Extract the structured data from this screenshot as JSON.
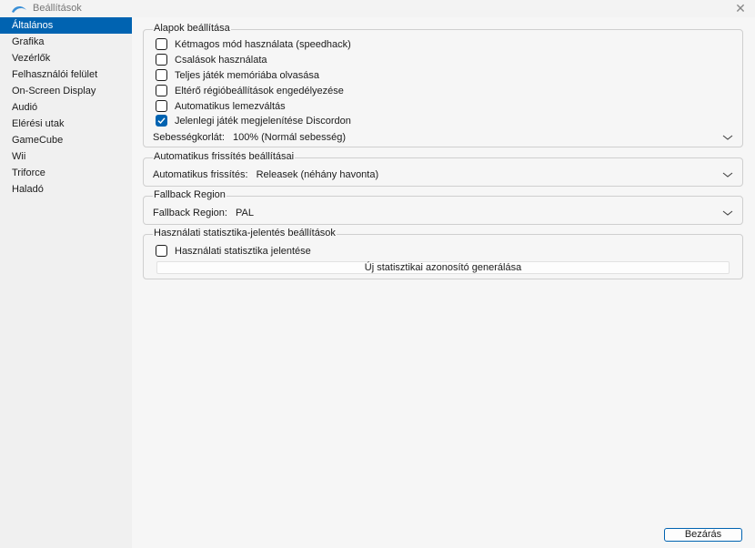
{
  "window": {
    "title": "Beállítások",
    "close_glyph": "✕"
  },
  "sidebar": {
    "items": [
      {
        "label": "Általános",
        "selected": true
      },
      {
        "label": "Grafika"
      },
      {
        "label": "Vezérlők"
      },
      {
        "label": "Felhasználói felület"
      },
      {
        "label": "On-Screen Display"
      },
      {
        "label": "Audió"
      },
      {
        "label": "Elérési utak"
      },
      {
        "label": "GameCube"
      },
      {
        "label": "Wii"
      },
      {
        "label": "Triforce"
      },
      {
        "label": "Haladó"
      }
    ]
  },
  "basic": {
    "title": "Alapok beállítása",
    "checkboxes": [
      {
        "label": "Kétmagos mód használata (speedhack)",
        "checked": false
      },
      {
        "label": "Csalások használata",
        "checked": false
      },
      {
        "label": "Teljes játék memóriába olvasása",
        "checked": false
      },
      {
        "label": "Eltérő régióbeállítások engedélyezése",
        "checked": false
      },
      {
        "label": "Automatikus lemezváltás",
        "checked": false
      },
      {
        "label": "Jelenlegi játék megjelenítése Discordon",
        "checked": true
      }
    ],
    "speed_label": "Sebességkorlát:",
    "speed_value": "100% (Normál sebesség)"
  },
  "autoupdate": {
    "title": "Automatikus frissítés beállításai",
    "label": "Automatikus frissítés:",
    "value": "Releasek (néhány havonta)"
  },
  "fallback": {
    "title": "Fallback Region",
    "label": "Fallback Region:",
    "value": "PAL"
  },
  "stats": {
    "title": "Használati statisztika-jelentés beállítások",
    "checkbox_label": "Használati statisztika jelentése",
    "checked": false,
    "generate_button": "Új statisztikai azonosító generálása"
  },
  "footer": {
    "close_button": "Bezárás"
  },
  "colors": {
    "accent": "#0063b1"
  }
}
